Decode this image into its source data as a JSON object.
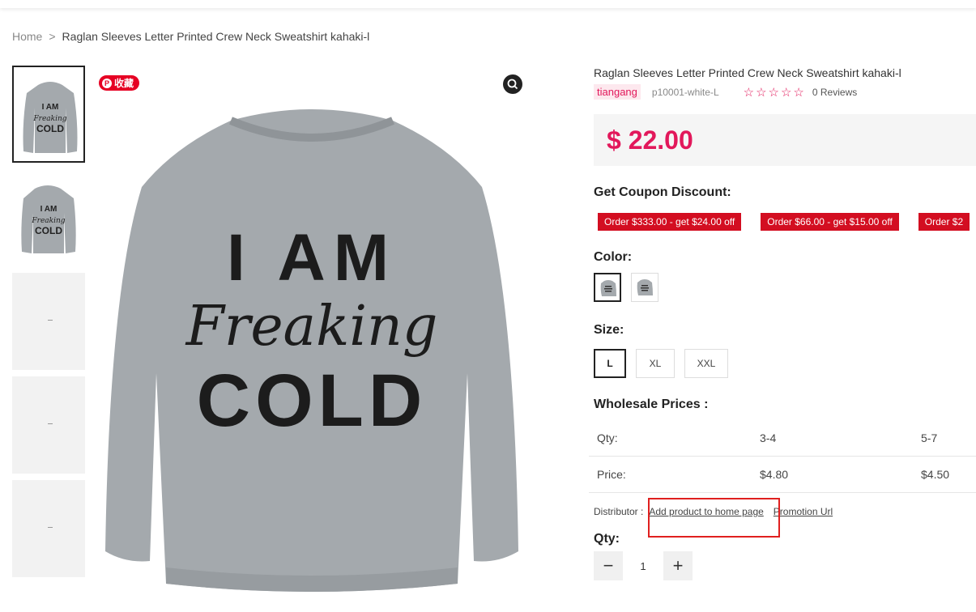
{
  "breadcrumb": {
    "home": "Home",
    "separator": ">",
    "current": "Raglan Sleeves Letter Printed Crew Neck Sweatshirt kahaki-l"
  },
  "gallery": {
    "pin_label": "收藏",
    "main_image_text": [
      "I AM",
      "Freaking",
      "COLD"
    ],
    "mini_text": [
      "I AM",
      "Freaking",
      "COLD"
    ]
  },
  "product": {
    "title": "Raglan Sleeves Letter Printed Crew Neck Sweatshirt kahaki-l",
    "brand": "tiangang",
    "sku": "p10001-white-L",
    "stars": "☆☆☆☆☆",
    "reviews": "0 Reviews",
    "price": "$ 22.00"
  },
  "coupons": {
    "title": "Get Coupon Discount:",
    "items": [
      "Order $333.00 - get $24.00 off",
      "Order $66.00 - get $15.00 off",
      "Order $2"
    ]
  },
  "color": {
    "title": "Color:"
  },
  "size": {
    "title": "Size:",
    "options": [
      "L",
      "XL",
      "XXL"
    ],
    "selected": "L"
  },
  "wholesale": {
    "title": "Wholesale Prices :",
    "rows": [
      {
        "label": "Qty:",
        "a": "3-4",
        "b": "5-7"
      },
      {
        "label": "Price:",
        "a": "$4.80",
        "b": "$4.50"
      }
    ]
  },
  "distributor": {
    "label": "Distributor :",
    "add_link": "Add product to home page",
    "promo_link": "Promotion Url"
  },
  "qty": {
    "title": "Qty:",
    "value": "1",
    "minus": "−",
    "plus": "+"
  },
  "colors": {
    "brand": "#e2185b",
    "coupon": "#d30e21",
    "highlight": "#e0201f",
    "shirt": "#a4a9ad"
  }
}
